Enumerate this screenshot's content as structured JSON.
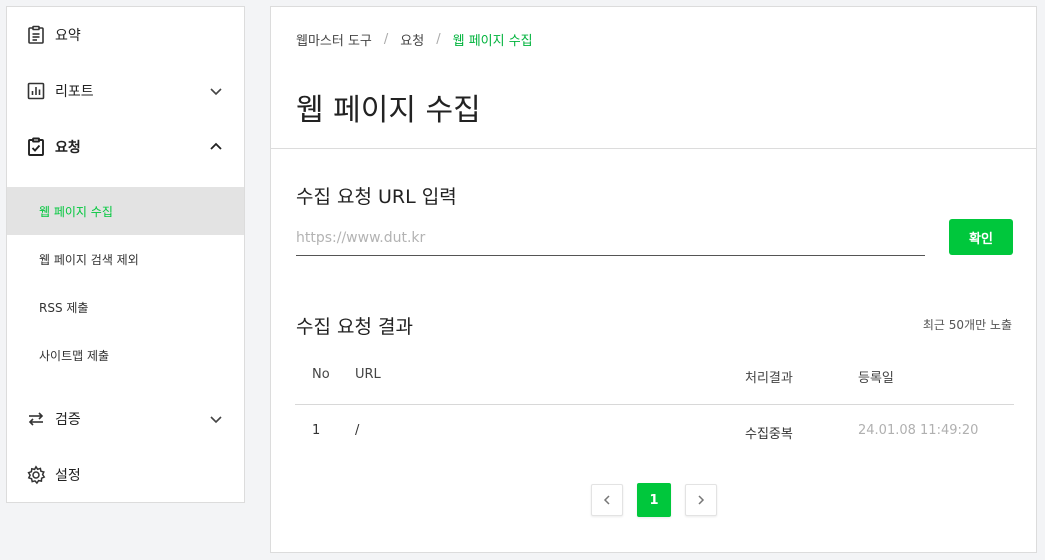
{
  "sidebar": {
    "items": [
      {
        "label": "요약",
        "icon": "clipboard-icon"
      },
      {
        "label": "리포트",
        "icon": "chart-icon",
        "chevron": "down"
      },
      {
        "label": "요청",
        "icon": "clipboard-check-icon",
        "chevron": "up"
      },
      {
        "label": "검증",
        "icon": "sync-icon",
        "chevron": "down"
      },
      {
        "label": "설정",
        "icon": "gear-icon"
      }
    ],
    "sub_items": [
      {
        "label": "웹 페이지 수집",
        "active": true
      },
      {
        "label": "웹 페이지 검색 제외"
      },
      {
        "label": "RSS 제출"
      },
      {
        "label": "사이트맵 제출"
      }
    ]
  },
  "breadcrumb": {
    "items": [
      "웹마스터 도구",
      "요청",
      "웹 페이지 수집"
    ],
    "separator": "/"
  },
  "page_title": "웹 페이지 수집",
  "request_section": {
    "title": "수집 요청 URL 입력",
    "input_placeholder": "https://www.dut.kr",
    "input_value": "",
    "confirm_label": "확인"
  },
  "result_section": {
    "title": "수집 요청 결과",
    "note": "최근 50개만 노출",
    "columns": [
      "No",
      "URL",
      "처리결과",
      "등록일"
    ],
    "rows": [
      {
        "no": "1",
        "url": "/",
        "result": "수집중복",
        "date": "24.01.08 11:49:20"
      }
    ]
  },
  "pagination": {
    "current_page": "1",
    "prev_icon": "chevron-left-icon",
    "next_icon": "chevron-right-icon"
  },
  "colors": {
    "accent": "#00c73c",
    "breadcrumb_current": "#00b33c",
    "active_sub_bg": "#e3e3e3"
  }
}
